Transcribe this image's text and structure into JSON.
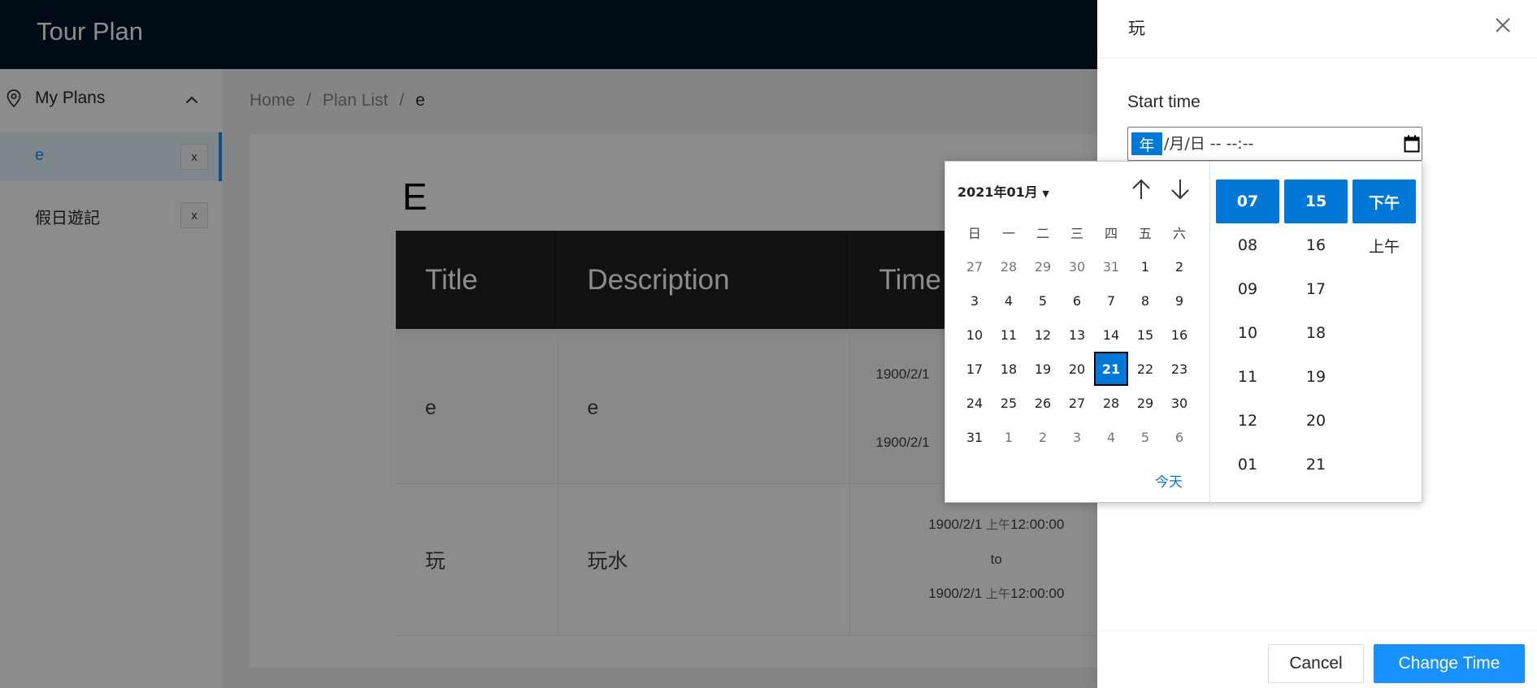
{
  "app": {
    "title": "Tour Plan"
  },
  "sidebar": {
    "group_label": "My Plans",
    "items": [
      {
        "label": "e",
        "close": "x",
        "active": true
      },
      {
        "label": "假日遊記",
        "close": "x",
        "active": false
      }
    ]
  },
  "breadcrumb": [
    "Home",
    "/",
    "Plan List",
    "/",
    "e"
  ],
  "plan": {
    "title": "E",
    "columns": [
      "Title",
      "Description",
      "Time"
    ],
    "rows": [
      {
        "title": "e",
        "description": "e",
        "start": "1900/2/1",
        "end": "1900/2/1"
      },
      {
        "title": "玩",
        "description": "玩水",
        "start_date": "1900/2/1",
        "start_period": "上午",
        "start_time": "12:00:00",
        "to": "to",
        "end_date": "1900/2/1",
        "end_period": "上午",
        "end_time": "12:00:00"
      }
    ]
  },
  "drawer": {
    "title": "玩",
    "field_label": "Start time",
    "input": {
      "year_seg": "年",
      "rest": "/月/日 -- --:--"
    },
    "cancel_label": "Cancel",
    "submit_label": "Change Time"
  },
  "picker": {
    "month_label": "2021年01月",
    "weekdays": [
      "日",
      "一",
      "二",
      "三",
      "四",
      "五",
      "六"
    ],
    "days": [
      [
        "27",
        "28",
        "29",
        "30",
        "31",
        "1",
        "2"
      ],
      [
        "3",
        "4",
        "5",
        "6",
        "7",
        "8",
        "9"
      ],
      [
        "10",
        "11",
        "12",
        "13",
        "14",
        "15",
        "16"
      ],
      [
        "17",
        "18",
        "19",
        "20",
        "21",
        "22",
        "23"
      ],
      [
        "24",
        "25",
        "26",
        "27",
        "28",
        "29",
        "30"
      ],
      [
        "31",
        "1",
        "2",
        "3",
        "4",
        "5",
        "6"
      ]
    ],
    "selected_day": "21",
    "today_label": "今天",
    "hours": [
      "07",
      "08",
      "09",
      "10",
      "11",
      "12",
      "01"
    ],
    "minutes": [
      "15",
      "16",
      "17",
      "18",
      "19",
      "20",
      "21"
    ],
    "periods": [
      "下午",
      "上午"
    ]
  },
  "colors": {
    "header_bg": "#001529",
    "primary": "#1890ff",
    "picker_accent": "#0078d7"
  }
}
